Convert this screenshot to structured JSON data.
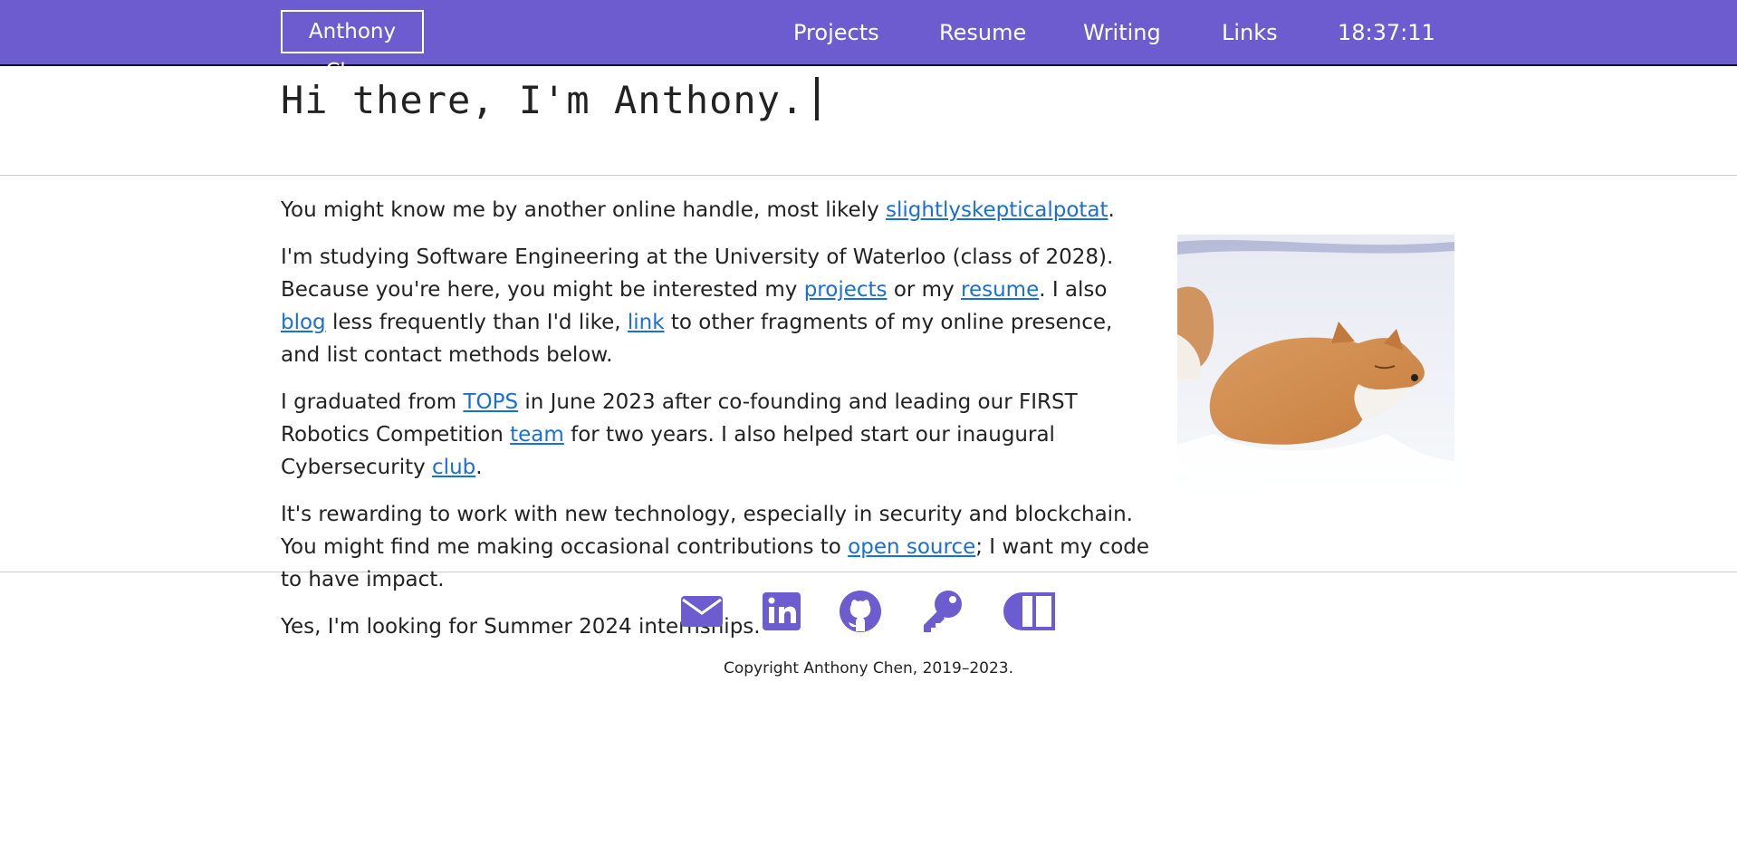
{
  "header": {
    "brand": "Anthony Chen",
    "nav": [
      "Projects",
      "Resume",
      "Writing",
      "Links"
    ],
    "clock": "18:37:11",
    "background": "#6d5ccf"
  },
  "hero": {
    "title": "Hi there, I'm Anthony."
  },
  "content": {
    "p1": {
      "pre": "You might know me by another online handle, most likely ",
      "link": "slightlyskepticalpotat",
      "post": "."
    },
    "p2": {
      "a": "I'm studying Software Engineering at the University of Waterloo (class of 2028). Because you're here, you might be interested my ",
      "link1": "projects",
      "b": " or my ",
      "link2": "resume",
      "c": ". I also ",
      "link3": "blog",
      "d": " less frequently than I'd like, ",
      "link4": "link",
      "e": " to other fragments of my online presence, and list contact methods below."
    },
    "p3": {
      "a": "I graduated from ",
      "link1": "TOPS",
      "b": " in June 2023 after co-founding and leading our FIRST Robotics Competition ",
      "link2": "team",
      "c": " for two years. I also helped start our inaugural Cybersecurity ",
      "link3": "club",
      "d": "."
    },
    "p4": {
      "a": "It's rewarding to work with new technology, especially in security and blockchain. You might find me making occasional contributions to ",
      "link": "open source",
      "b": "; I want my code to have impact."
    },
    "p5": "Yes, I'm looking for Summer 2024 internships."
  },
  "social": {
    "icons": [
      "email-icon",
      "linkedin-icon",
      "github-icon",
      "key-icon",
      "toggle-icon"
    ],
    "copyright": "Copyright Anthony Chen, 2019–2023."
  },
  "colors": {
    "accent": "#6d5ccf",
    "link": "#1a6ed8"
  }
}
